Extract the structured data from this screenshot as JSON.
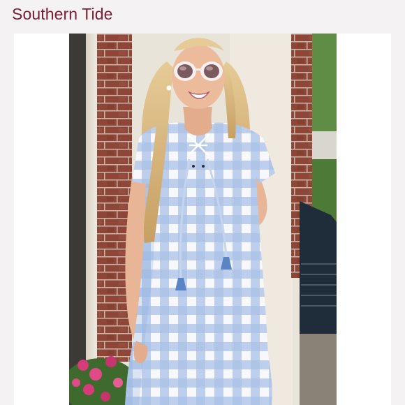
{
  "listing": {
    "brand": "Southern Tide"
  },
  "photo": {
    "subject": "model-wearing-gingham-dress",
    "colors": {
      "gingham_light": "#dbe6f6",
      "gingham_mid": "#a9c1e6",
      "gingham_dark": "#88a6d8",
      "brick": "#8e4638",
      "pillar": "#f1ece2",
      "hair": "#d9b982",
      "skin": "#e8b596",
      "flowers": "#d63b7a",
      "foliage": "#3f6a2e"
    }
  },
  "theme": {
    "brand_color": "#7b1d34",
    "background": "#f4f2f3",
    "card": "#ffffff"
  }
}
